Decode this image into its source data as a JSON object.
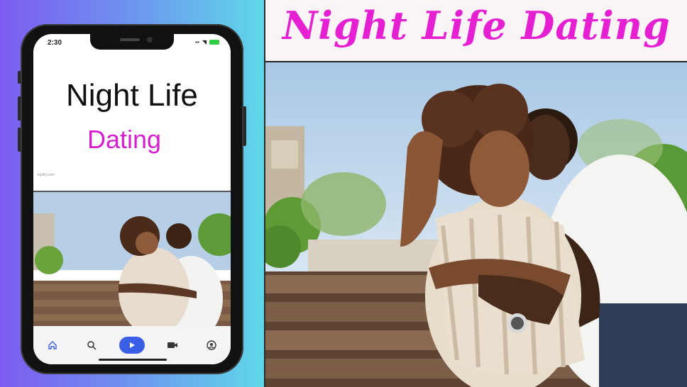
{
  "banner": {
    "title": "Night Life Dating"
  },
  "phone": {
    "status_time": "2:30",
    "app_title": "Night Life",
    "app_subtitle": "Dating",
    "footer_url": "triplify.com",
    "nav": [
      {
        "icon": "home-icon",
        "active": false
      },
      {
        "icon": "search-icon",
        "active": false
      },
      {
        "icon": "play-icon",
        "active": true
      },
      {
        "icon": "video-icon",
        "active": false
      },
      {
        "icon": "account-icon",
        "active": false
      }
    ]
  },
  "colors": {
    "brand_magenta": "#e51fd2",
    "gradient_left": "#7c5cf0",
    "gradient_right": "#5fd8e8",
    "nav_active": "#3b5ee6"
  }
}
